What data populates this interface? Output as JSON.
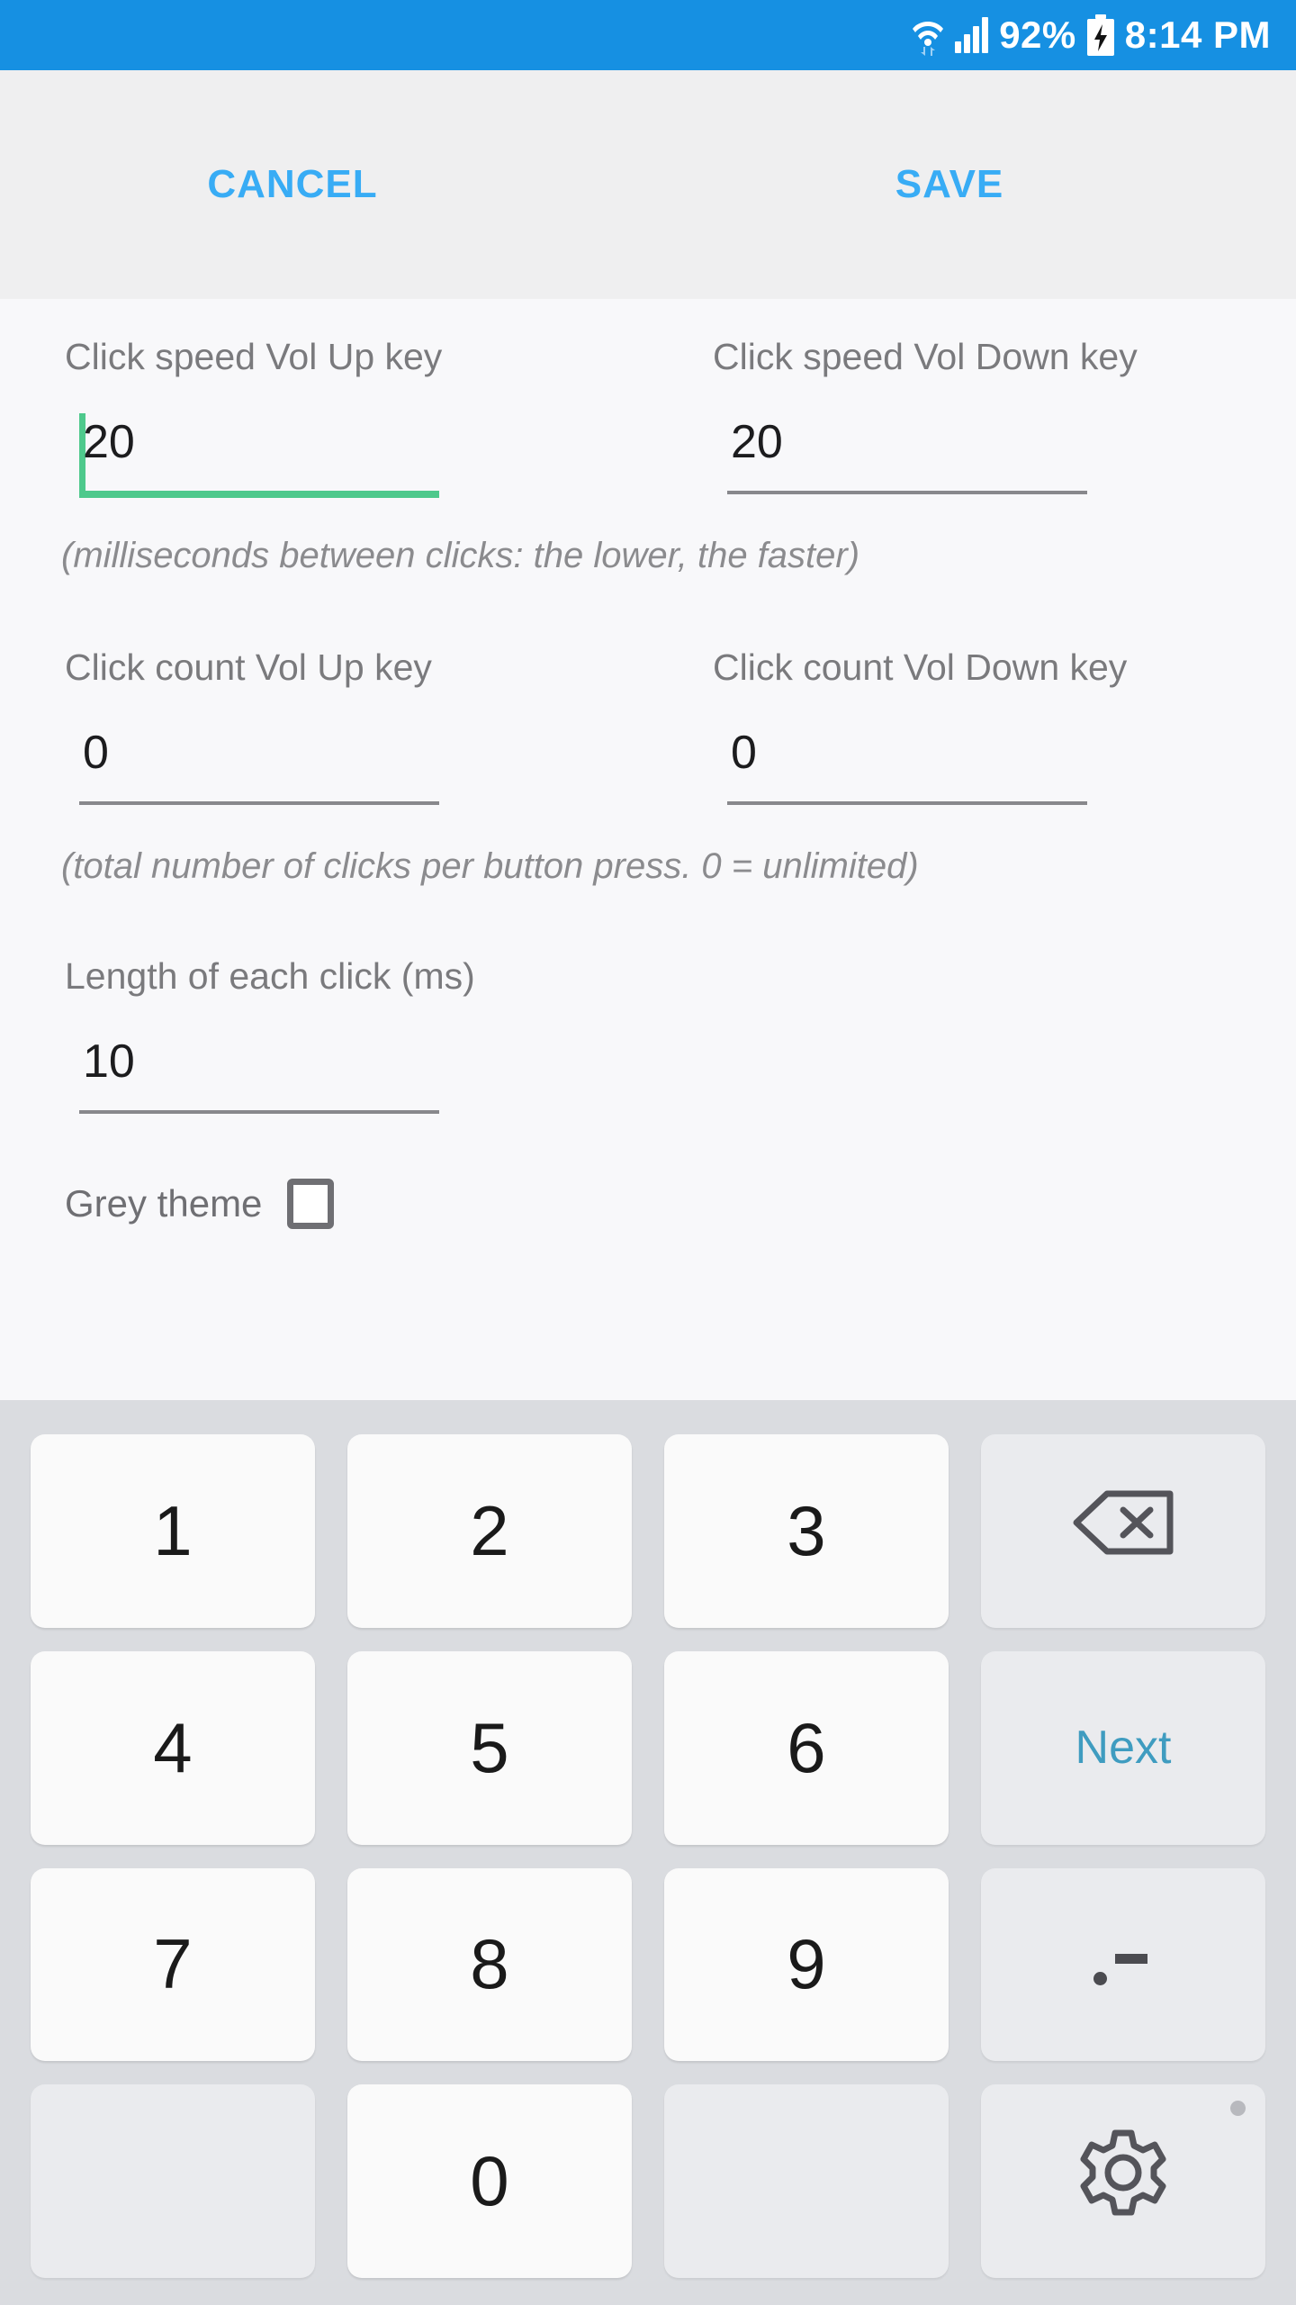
{
  "status_bar": {
    "battery_percent": "92%",
    "time": "8:14 PM",
    "icons": [
      "wifi-icon",
      "cellular-signal-icon",
      "battery-charging-icon"
    ],
    "background_color": "#1690e2"
  },
  "toolbar": {
    "cancel_label": "CANCEL",
    "save_label": "SAVE",
    "accent_color": "#38acf5",
    "background_color": "#efeff0"
  },
  "form": {
    "accent_focus_color": "#4ec98c",
    "rows": [
      {
        "left": {
          "label": "Click speed Vol Up key",
          "value": "20",
          "focused": true
        },
        "right": {
          "label": "Click speed Vol Down key",
          "value": "20",
          "focused": false
        }
      },
      {
        "left": {
          "label": "Click count Vol Up key",
          "value": "0",
          "focused": false
        },
        "right": {
          "label": "Click count Vol Down key",
          "value": "0",
          "focused": false
        }
      }
    ],
    "hint_speed": "(milliseconds between clicks: the lower, the faster)",
    "hint_count": "(total number of clicks per button press. 0 = unlimited)",
    "length_field": {
      "label": "Length of each click (ms)",
      "value": "10"
    },
    "grey_theme": {
      "label": "Grey theme",
      "checked": false
    }
  },
  "keyboard": {
    "background_color": "#dadce0",
    "next_key_color": "#3f9cc0",
    "rows": [
      [
        {
          "label": "1",
          "name": "key-1",
          "type": "digit"
        },
        {
          "label": "2",
          "name": "key-2",
          "type": "digit"
        },
        {
          "label": "3",
          "name": "key-3",
          "type": "digit"
        },
        {
          "label": "",
          "name": "backspace-key",
          "type": "backspace"
        }
      ],
      [
        {
          "label": "4",
          "name": "key-4",
          "type": "digit"
        },
        {
          "label": "5",
          "name": "key-5",
          "type": "digit"
        },
        {
          "label": "6",
          "name": "key-6",
          "type": "digit"
        },
        {
          "label": "Next",
          "name": "next-key",
          "type": "next"
        }
      ],
      [
        {
          "label": "7",
          "name": "key-7",
          "type": "digit"
        },
        {
          "label": "8",
          "name": "key-8",
          "type": "digit"
        },
        {
          "label": "9",
          "name": "key-9",
          "type": "digit"
        },
        {
          "label": ".-",
          "name": "dot-dash-key",
          "type": "dotdash"
        }
      ],
      [
        {
          "label": "",
          "name": "blank-key-left",
          "type": "blank"
        },
        {
          "label": "0",
          "name": "key-0",
          "type": "digit"
        },
        {
          "label": "",
          "name": "blank-key-right",
          "type": "blank"
        },
        {
          "label": "",
          "name": "keyboard-settings-key",
          "type": "gear"
        }
      ]
    ]
  }
}
